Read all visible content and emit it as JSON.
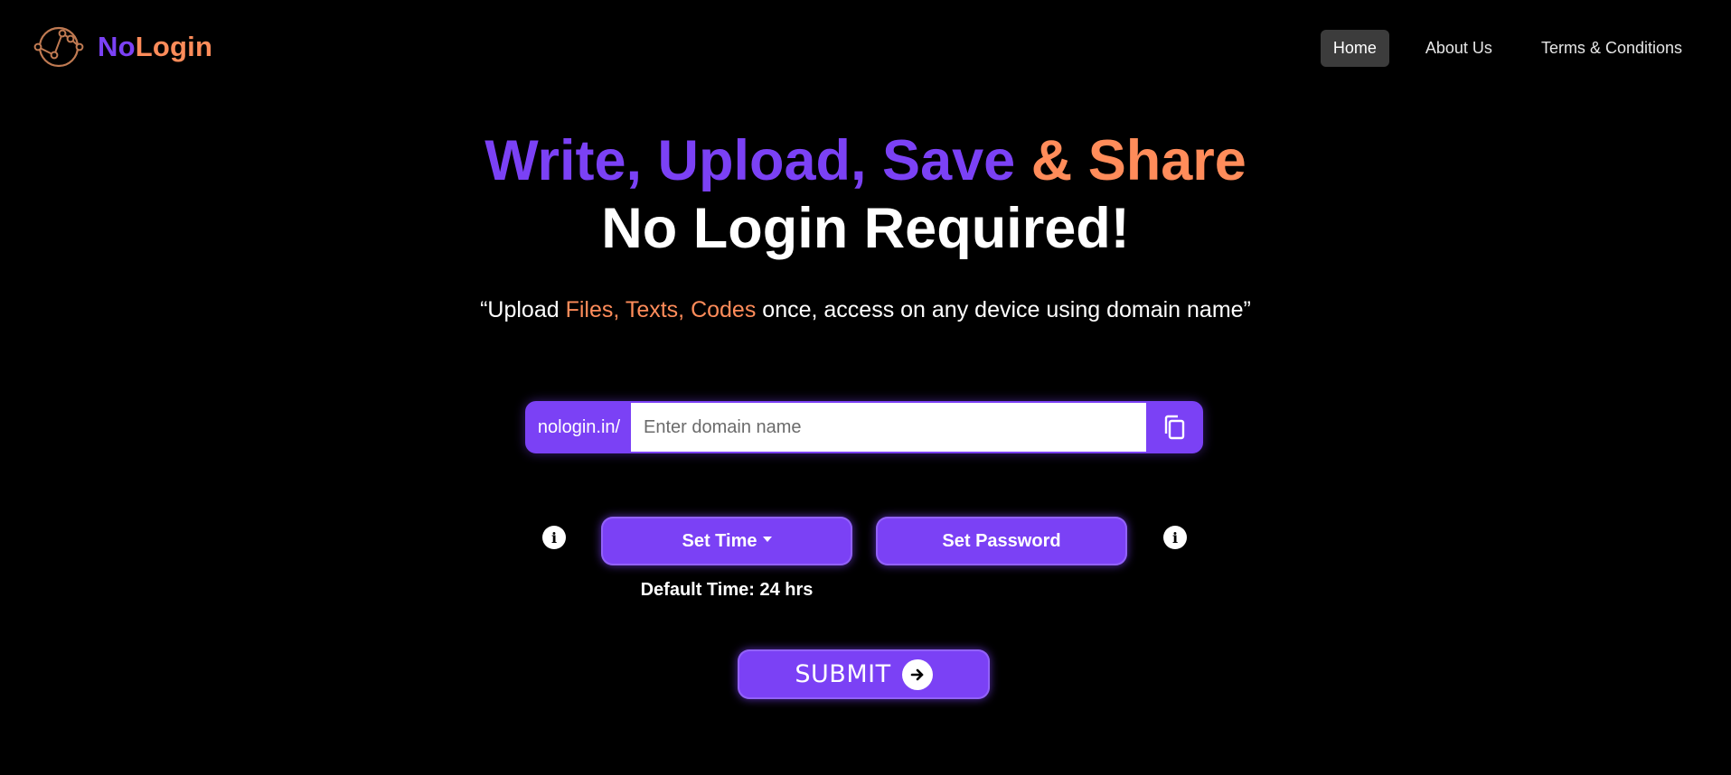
{
  "header": {
    "brand_part1": "No",
    "brand_part2": "Login",
    "logo_icon": "network-nodes-icon",
    "nav": [
      {
        "label": "Home",
        "active": true
      },
      {
        "label": "About Us",
        "active": false
      },
      {
        "label": "Terms & Conditions",
        "active": false
      }
    ]
  },
  "hero": {
    "line1_part1": "Write, Upload, Save",
    "line1_part2": "& Share",
    "line2": "No Login Required!",
    "tagline_prefix": "“Upload",
    "tagline_highlight": "Files, Texts, Codes",
    "tagline_suffix": "once, access on any device using domain name”"
  },
  "domain": {
    "prefix": "nologin.in/",
    "value": "",
    "placeholder": "Enter domain name",
    "copy_icon": "copy-icon"
  },
  "options": {
    "set_time_label": "Set Time",
    "set_password_label": "Set Password",
    "default_time": "Default Time: 24 hrs",
    "info_glyph": "i"
  },
  "submit": {
    "label": "SUBMIT",
    "icon": "arrow-right-icon"
  },
  "colors": {
    "background": "#000000",
    "accent_purple": "#7b41f5",
    "accent_orange": "#ff8c5a",
    "nav_active_bg": "#3c3c3c"
  }
}
